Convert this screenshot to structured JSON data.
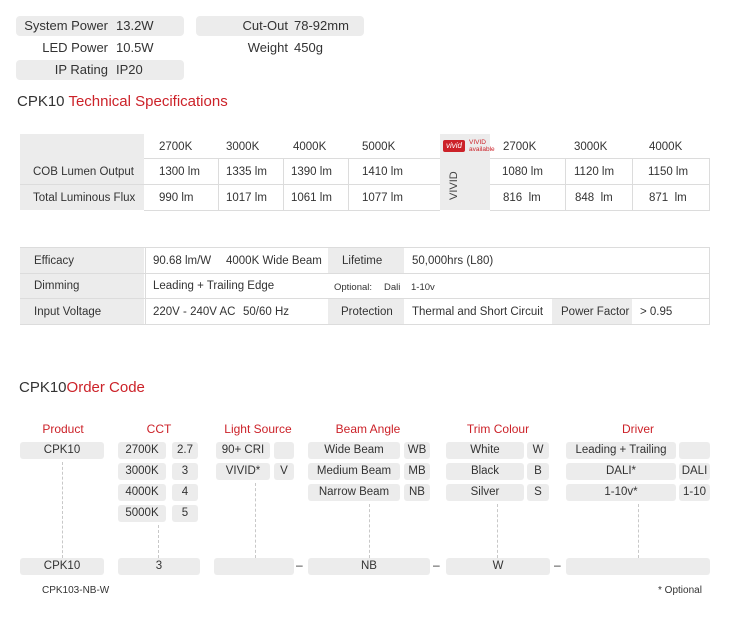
{
  "specs_top": [
    {
      "label": "System Power",
      "value": "13.2W"
    },
    {
      "label": "LED Power",
      "value": "10.5W"
    },
    {
      "label": "IP Rating",
      "value": "IP20"
    },
    {
      "label": "Cut-Out",
      "value": "78-92mm"
    },
    {
      "label": "Weight",
      "value": "450g"
    }
  ],
  "tech_title": {
    "model": "CPK10",
    "text": "Technical Specifications"
  },
  "lumen_table": {
    "cct": [
      "2700K",
      "3000K",
      "4000K",
      "5000K"
    ],
    "vivid_cct": [
      "2700K",
      "3000K",
      "4000K"
    ],
    "vivid_logo": "vivid",
    "vivid_available": "VIVID available",
    "vivid_vertical": "VIVID",
    "rows": [
      {
        "label": "COB Lumen Output",
        "values": [
          "1300 lm",
          "1335 lm",
          "1390 lm",
          "1410 lm"
        ],
        "vivid": [
          "1080 lm",
          "1120 lm",
          "1150 lm"
        ]
      },
      {
        "label": "Total Luminous Flux",
        "values": [
          "990 lm",
          "1017 lm",
          "1061 lm",
          "1077 lm"
        ],
        "vivid": [
          "816  lm",
          "848  lm",
          "871  lm"
        ]
      }
    ]
  },
  "info_table": {
    "efficacy": {
      "label": "Efficacy",
      "value": "90.68 lm/W",
      "extra": "4000K Wide Beam"
    },
    "lifetime": {
      "label": "Lifetime",
      "value": "50,000hrs (L80)"
    },
    "dimming": {
      "label": "Dimming",
      "value": "Leading + Trailing Edge",
      "optional": "Optional:",
      "dali": "Dali",
      "v110": "1-10v"
    },
    "input_voltage": {
      "label": "Input Voltage",
      "value": "220V - 240V AC",
      "freq": "50/60 Hz"
    },
    "protection": {
      "label": "Protection",
      "value": "Thermal and Short Circuit"
    },
    "power_factor": {
      "label": "Power Factor",
      "value": "> 0.95"
    }
  },
  "order_title": {
    "model": "CPK10",
    "text": "Order Code"
  },
  "order": {
    "headers": [
      "Product",
      "CCT",
      "Light Source",
      "Beam Angle",
      "Trim Colour",
      "Driver"
    ],
    "product": "CPK10",
    "cct": [
      [
        "2700K",
        "2.7"
      ],
      [
        "3000K",
        "3"
      ],
      [
        "4000K",
        "4"
      ],
      [
        "5000K",
        "5"
      ]
    ],
    "light_source": [
      [
        "90+ CRI",
        ""
      ],
      [
        "VIVID*",
        "V"
      ]
    ],
    "beam": [
      [
        "Wide Beam",
        "WB"
      ],
      [
        "Medium Beam",
        "MB"
      ],
      [
        "Narrow Beam",
        "NB"
      ]
    ],
    "trim": [
      [
        "White",
        "W"
      ],
      [
        "Black",
        "B"
      ],
      [
        "Silver",
        "S"
      ]
    ],
    "driver": [
      [
        "Leading + Trailing",
        ""
      ],
      [
        "DALI*",
        "DALI"
      ],
      [
        "1-10v*",
        "1-10"
      ]
    ],
    "result": {
      "product": "CPK10",
      "cct": "3",
      "light": "",
      "beam": "NB",
      "trim": "W",
      "driver": ""
    },
    "separator": "–",
    "example": "CPK103-NB-W",
    "optional_note": "* Optional"
  },
  "colors": {
    "accent": "#cc2229",
    "shade": "#ececec"
  }
}
